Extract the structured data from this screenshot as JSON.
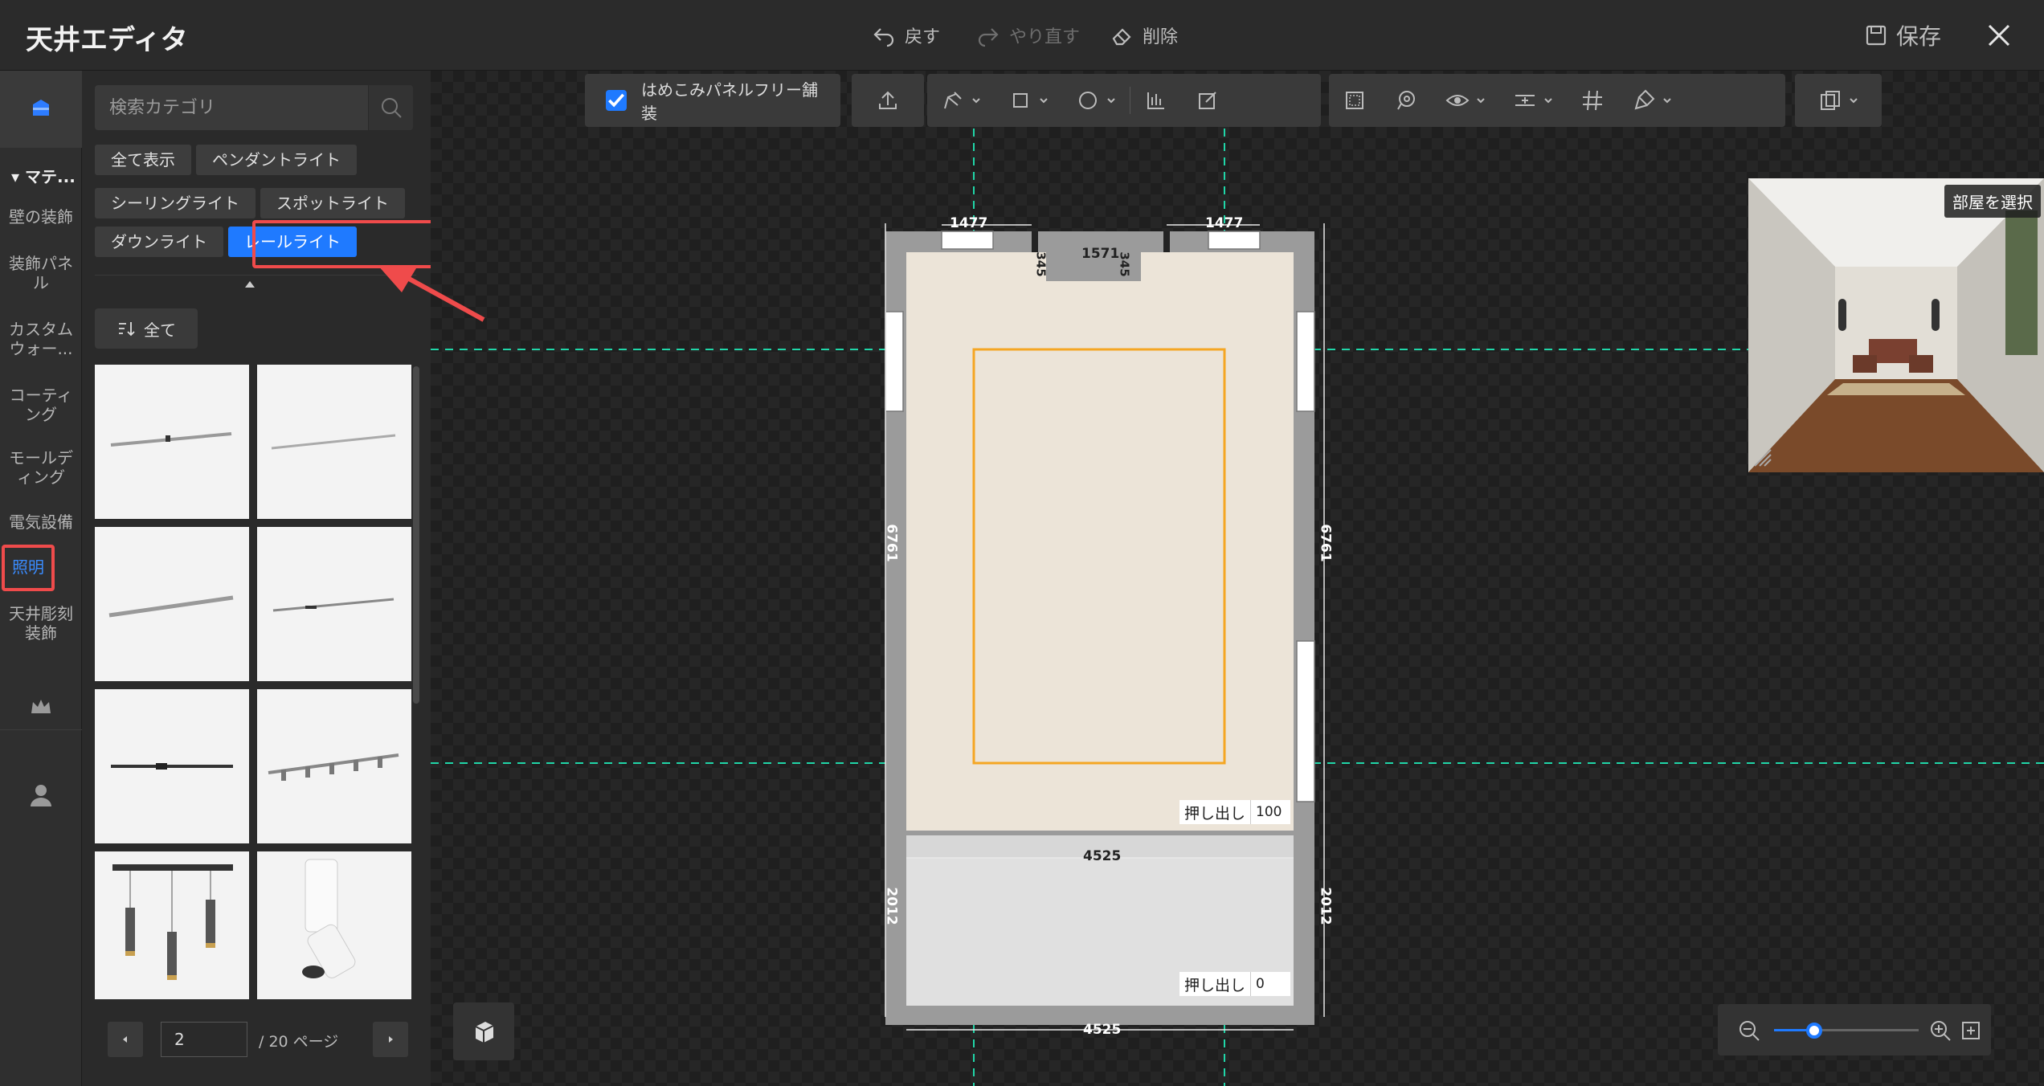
{
  "app": {
    "title": "天井エディタ",
    "undo_label": "戻す",
    "redo_label": "やり直す",
    "delete_label": "削除",
    "save_label": "保存"
  },
  "rail": {
    "section_label": "▾ マテ...",
    "items": [
      {
        "label": "壁の装飾"
      },
      {
        "label": "装飾パネル"
      },
      {
        "label": "カスタムウォー..."
      },
      {
        "label": "コーティング"
      },
      {
        "label": "モールディング"
      },
      {
        "label": "電気設備"
      },
      {
        "label": "照明"
      },
      {
        "label": "天井彫刻装飾"
      }
    ],
    "icons": [
      "home-box-icon",
      "crown-icon",
      "user-icon"
    ]
  },
  "panel": {
    "search_placeholder": "検索カテゴリ",
    "chips": [
      "全て表示",
      "ペンダントライト",
      "シーリングライト",
      "スポットライト",
      "ダウンライト",
      "レールライト"
    ],
    "selected_chip": "レールライト",
    "sort_label": "全て",
    "pager": {
      "current": "2",
      "total_label": "/ 20 ページ"
    }
  },
  "toolbar": {
    "seamless_label": "はめこみパネルフリー舗装",
    "seamless_checked": true
  },
  "plan": {
    "dim_top_left": "1477",
    "dim_top_right": "1477",
    "dim_top_middle": "1571",
    "dim_notch_left": "345",
    "dim_notch_right": "345",
    "dim_side_upper_left": "6761",
    "dim_side_upper_right": "6761",
    "dim_side_lower_left": "2012",
    "dim_side_lower_right": "2012",
    "dim_middle": "4525",
    "dim_bottom": "4525",
    "extrude_label_1": "押し出し",
    "extrude_value_1": "100",
    "extrude_label_2": "押し出し",
    "extrude_value_2": "0"
  },
  "preview": {
    "select_room_label": "部屋を選択"
  },
  "colors": {
    "accent": "#1f7aff",
    "highlight": "#ef4b4b",
    "guide": "#20d6a8",
    "selection": "#f5a623"
  }
}
